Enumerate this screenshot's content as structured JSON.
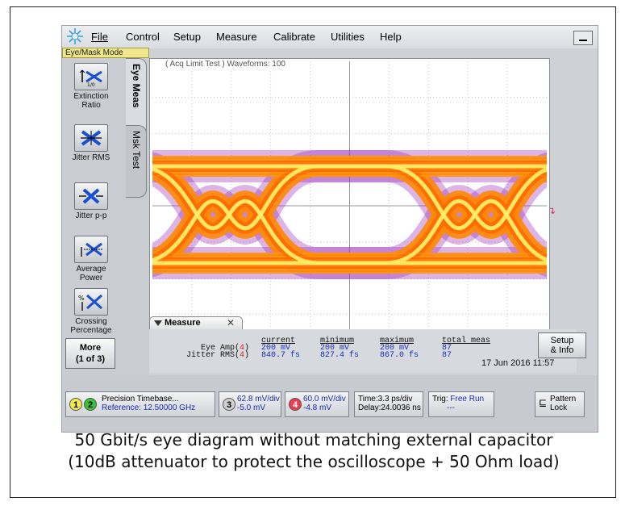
{
  "menu": {
    "file": "File",
    "control": "Control",
    "setup": "Setup",
    "measure": "Measure",
    "calibrate": "Calibrate",
    "utilities": "Utilities",
    "help": "Help"
  },
  "mode_label": "Eye/Mask Mode",
  "tabs": {
    "eye_meas": "Eye Meas",
    "msk_test": "Msk Test"
  },
  "tools": [
    {
      "label": "Extinction Ratio",
      "icon": "extinction-ratio-icon"
    },
    {
      "label": "Jitter RMS",
      "icon": "jitter-rms-icon"
    },
    {
      "label": "Jitter p-p",
      "icon": "jitter-pp-icon"
    },
    {
      "label": "Average Power",
      "icon": "average-power-icon"
    },
    {
      "label": "Crossing Percentage",
      "icon": "crossing-percentage-icon"
    }
  ],
  "more_button": {
    "line1": "More",
    "line2": "(1 of 3)"
  },
  "waveform_info": "( Acq Limit Test )  Waveforms: 100",
  "measure": {
    "title": "Measure",
    "headers": [
      "current",
      "minimum",
      "maximum",
      "total meas"
    ],
    "rows": [
      {
        "name": "Eye Amp(",
        "channel": "4",
        "close": ")",
        "values": [
          "200 mV",
          "200 mV",
          "200 mV",
          "87"
        ]
      },
      {
        "name": "Jitter RMS(",
        "channel": "4",
        "close": ")",
        "values": [
          "840.7 fs",
          "827.4 fs",
          "867.0 fs",
          "87"
        ]
      }
    ],
    "setup_info": {
      "line1": "Setup",
      "line2": "& Info"
    }
  },
  "datetime": "17 Jun 2016  11:57",
  "status": {
    "timebase": {
      "ch1": "1",
      "ch2": "2",
      "line1": "Precision Timebase...",
      "line2": "Reference: 12.50000 GHz"
    },
    "ch3": {
      "num": "3",
      "line1": "62.8 mV/div",
      "line2": "-5.0 mV"
    },
    "ch4": {
      "num": "4",
      "line1": "60.0 mV/div",
      "line2": "-4.8 mV"
    },
    "time": {
      "line1": "Time:3.3 ps/div",
      "line2": "Delay:24.0036 ns"
    },
    "trig": {
      "label": "Trig: ",
      "value": "Free Run",
      "line2": "---"
    },
    "pattern_lock": {
      "line1": "Pattern",
      "line2": "Lock"
    }
  },
  "caption": {
    "line1": "50 Gbit/s eye diagram without matching external capacitor",
    "line2": "(10dB attenuator to protect the oscilloscope + 50 Ohm load)"
  },
  "colors": {
    "trace_core": "#ffee66",
    "trace_mid": "#ff8a00",
    "trace_edge": "#9a2bb8",
    "channel4": "#e02020",
    "value_text": "#1a2ab8"
  }
}
